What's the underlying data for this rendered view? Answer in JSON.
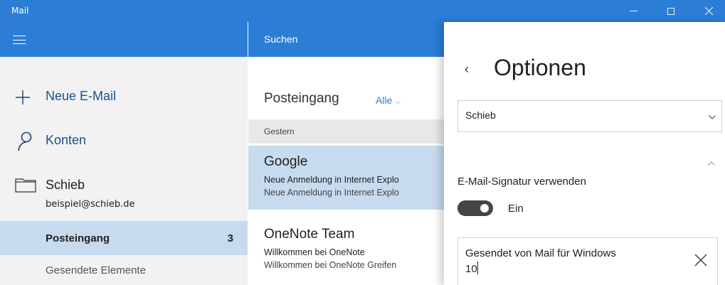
{
  "window": {
    "title": "Mail",
    "controls": [
      "minimize",
      "maximize",
      "close"
    ]
  },
  "nav": {
    "menu_icon": "hamburger-icon",
    "new_mail": {
      "label": "Neue E-Mail",
      "icon": "plus-icon"
    },
    "accounts": {
      "label": "Konten",
      "icon": "person-icon"
    },
    "account": {
      "name": "Schieb",
      "email": "beispiel@schieb.de",
      "icon": "folder-icon"
    },
    "folders": [
      {
        "label": "Posteingang",
        "count": "3",
        "selected": true
      },
      {
        "label": "Gesendete Elemente"
      }
    ]
  },
  "list": {
    "search_placeholder": "Suchen",
    "folder_title": "Posteingang",
    "filter_label": "Alle",
    "group_header": "Gestern",
    "messages": [
      {
        "from": "Google",
        "subject": "Neue Anmeldung in Internet Explo",
        "preview": "Neue Anmeldung in Internet Explo",
        "selected": true
      },
      {
        "from": "OneNote Team",
        "subject": "Willkommen bei OneNote",
        "preview": "Willkommen bei OneNote Greifen"
      }
    ]
  },
  "options": {
    "back_glyph": "‹",
    "title": "Optionen",
    "account_select": "Schieb",
    "signature_label": "E-Mail-Signatur verwenden",
    "toggle_on": true,
    "toggle_label": "Ein",
    "signature_text": "Gesendet von Mail für Windows\n10"
  },
  "colors": {
    "accent": "#2b7dd6",
    "selected": "#c7dbef",
    "nav_bg": "#f2f2f2",
    "toggle": "#454545"
  }
}
